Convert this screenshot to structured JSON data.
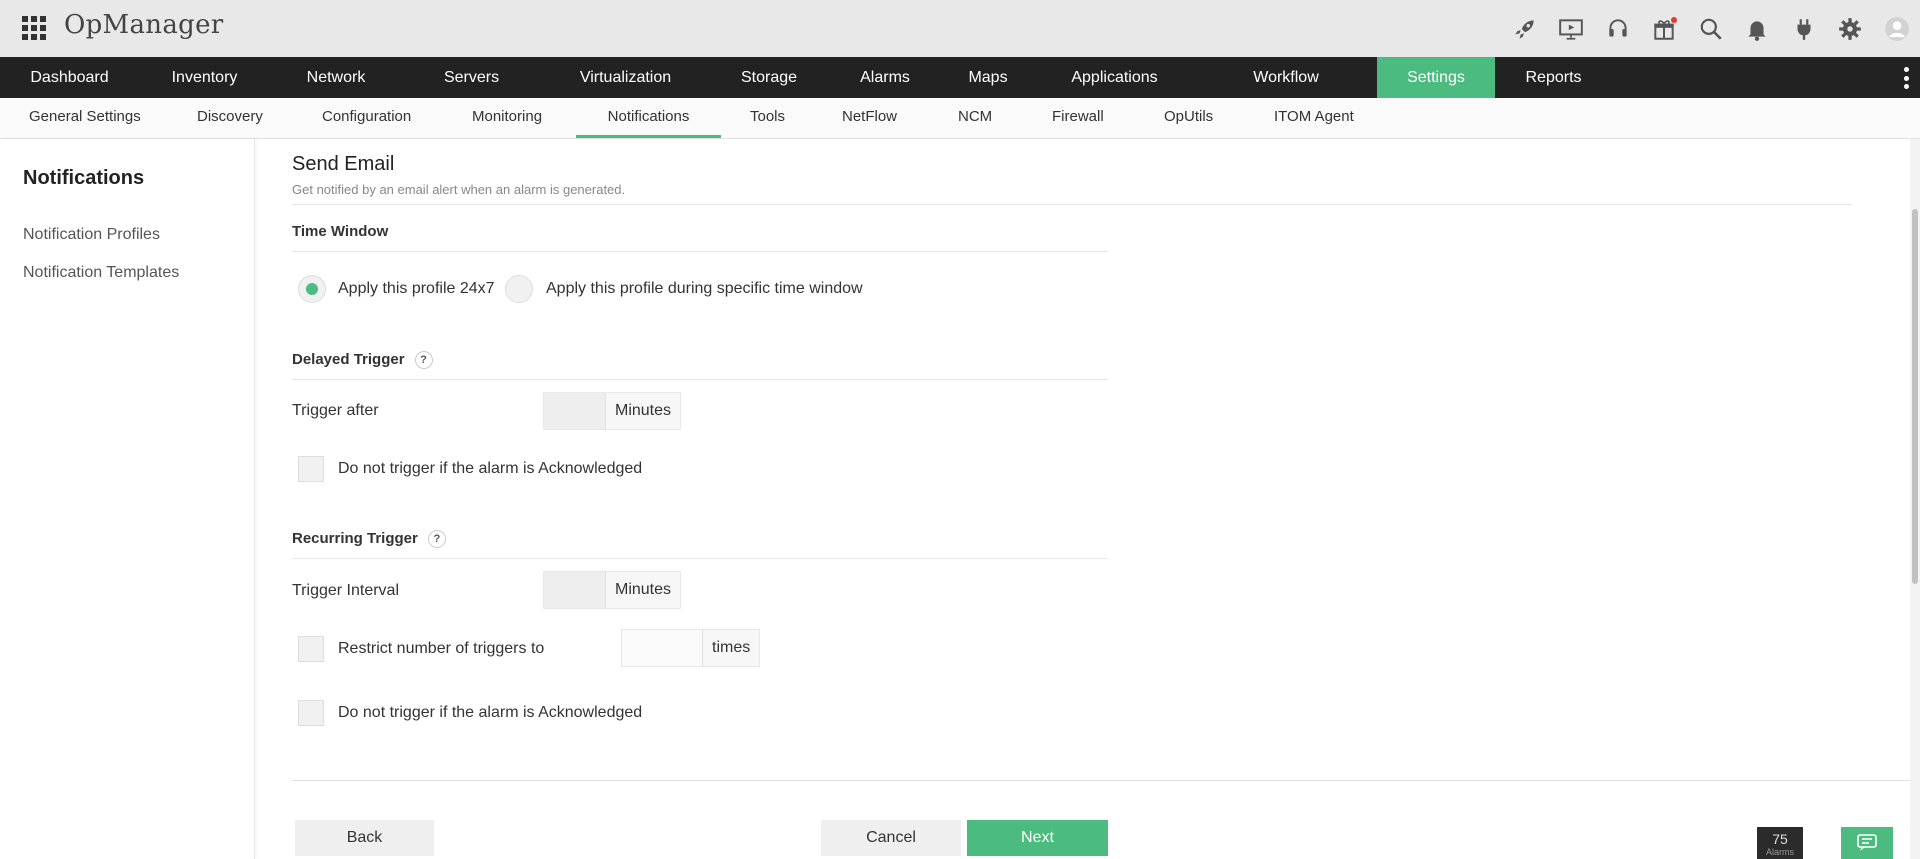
{
  "app": {
    "title": "OpManager"
  },
  "header_icons": [
    "rocket-icon",
    "presentation-play-icon",
    "headset-icon",
    "gift-icon",
    "search-icon",
    "bell-icon",
    "plug-icon",
    "gear-icon",
    "user-avatar-icon"
  ],
  "main_nav": [
    {
      "label": "Dashboard",
      "active": false
    },
    {
      "label": "Inventory",
      "active": false
    },
    {
      "label": "Network",
      "active": false
    },
    {
      "label": "Servers",
      "active": false
    },
    {
      "label": "Virtualization",
      "active": false
    },
    {
      "label": "Storage",
      "active": false
    },
    {
      "label": "Alarms",
      "active": false
    },
    {
      "label": "Maps",
      "active": false
    },
    {
      "label": "Applications",
      "active": false
    },
    {
      "label": "Workflow",
      "active": false
    },
    {
      "label": "Settings",
      "active": true
    },
    {
      "label": "Reports",
      "active": false
    }
  ],
  "sub_nav": [
    {
      "label": "General Settings",
      "active": false
    },
    {
      "label": "Discovery",
      "active": false
    },
    {
      "label": "Configuration",
      "active": false
    },
    {
      "label": "Monitoring",
      "active": false
    },
    {
      "label": "Notifications",
      "active": true
    },
    {
      "label": "Tools",
      "active": false
    },
    {
      "label": "NetFlow",
      "active": false
    },
    {
      "label": "NCM",
      "active": false
    },
    {
      "label": "Firewall",
      "active": false
    },
    {
      "label": "OpUtils",
      "active": false
    },
    {
      "label": "ITOM Agent",
      "active": false
    }
  ],
  "sidebar": {
    "title": "Notifications",
    "links": [
      "Notification Profiles",
      "Notification Templates"
    ]
  },
  "page": {
    "title": "Send Email",
    "subtitle": "Get notified by an email alert when an alarm is generated."
  },
  "time_window": {
    "heading": "Time Window",
    "options": [
      {
        "label": "Apply this profile 24x7",
        "selected": true
      },
      {
        "label": "Apply this profile during specific time window",
        "selected": false
      }
    ]
  },
  "delayed_trigger": {
    "heading": "Delayed Trigger",
    "help": "?",
    "trigger_after_label": "Trigger after",
    "trigger_after_value": "",
    "unit": "Minutes",
    "ack_label": "Do not trigger if the alarm is Acknowledged",
    "ack_checked": false
  },
  "recurring_trigger": {
    "heading": "Recurring Trigger",
    "help": "?",
    "interval_label": "Trigger Interval",
    "interval_value": "",
    "unit": "Minutes",
    "restrict_label": "Restrict number of triggers to",
    "restrict_checked": false,
    "restrict_value": "",
    "restrict_unit": "times",
    "ack_label": "Do not trigger if the alarm is Acknowledged",
    "ack_checked": false
  },
  "buttons": {
    "back": "Back",
    "cancel": "Cancel",
    "next": "Next"
  },
  "alarms_badge": {
    "count": "75",
    "label": "Alarms"
  },
  "colors": {
    "accent": "#4cbb7f",
    "nav_bg": "#222222",
    "topbar_bg": "#e8e8e8",
    "notify_dot": "#e53935"
  }
}
